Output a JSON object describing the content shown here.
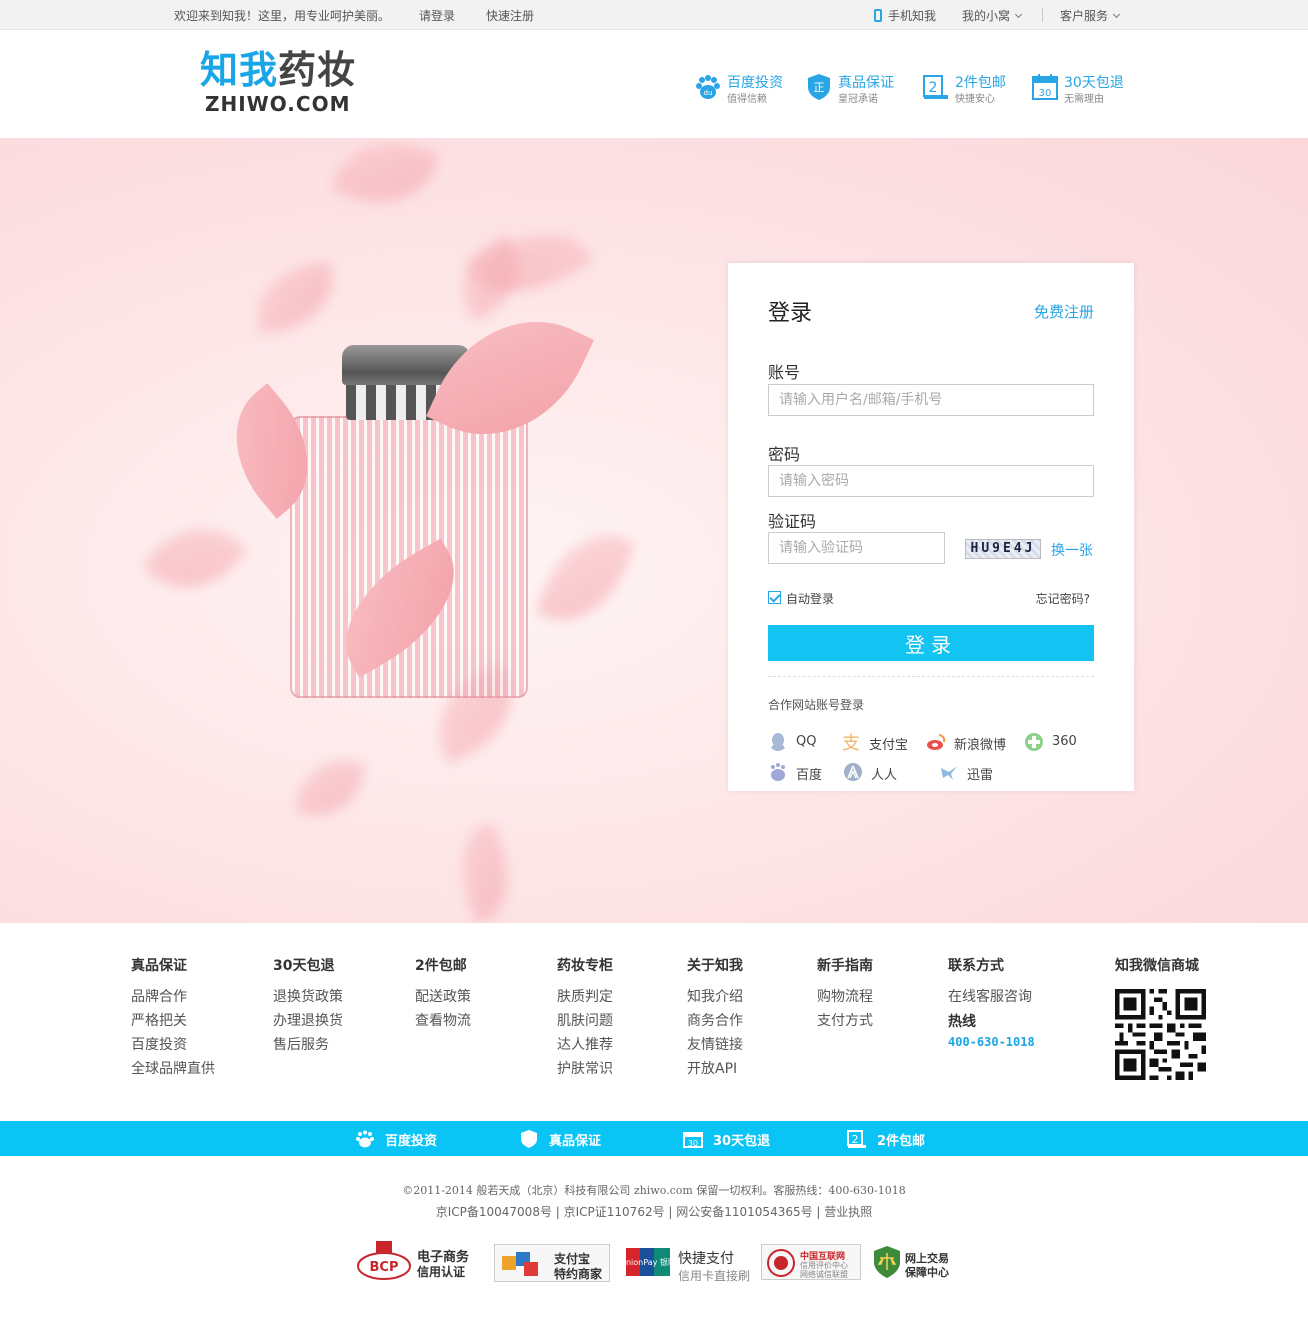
{
  "topbar": {
    "welcome": "欢迎来到知我！这里，用专业呵护美丽。",
    "login": "请登录",
    "register": "快速注册",
    "mobile": "手机知我",
    "my_home": "我的小窝",
    "service": "客户服务"
  },
  "header": {
    "logo_cn_a": "知我",
    "logo_cn_b": "药妆",
    "logo_en": "ZHIWO.COM",
    "promos": [
      {
        "title": "百度投资",
        "sub": "值得信赖",
        "icon": "baidu-paw-icon"
      },
      {
        "title": "真品保证",
        "sub": "皇冠承诺",
        "icon": "shield-icon"
      },
      {
        "title": "2件包邮",
        "sub": "快捷安心",
        "icon": "delivery-icon"
      },
      {
        "title": "30天包退",
        "sub": "无需理由",
        "icon": "calendar-icon"
      }
    ]
  },
  "login": {
    "title": "登录",
    "register_link": "免费注册",
    "account_label": "账号",
    "account_placeholder": "请输入用户名/邮箱/手机号",
    "password_label": "密码",
    "password_placeholder": "请输入密码",
    "captcha_label": "验证码",
    "captcha_placeholder": "请输入验证码",
    "captcha_text": "HU9E4J",
    "captcha_swap": "换一张",
    "auto_login": "自动登录",
    "forgot": "忘记密码?",
    "button": "登录",
    "partner_label": "合作网站账号登录",
    "social": [
      {
        "label": "QQ",
        "icon": "qq-icon"
      },
      {
        "label": "支付宝",
        "icon": "alipay-icon"
      },
      {
        "label": "新浪微博",
        "icon": "weibo-icon"
      },
      {
        "label": "360",
        "icon": "360-icon"
      },
      {
        "label": "百度",
        "icon": "baidu-icon"
      },
      {
        "label": "人人",
        "icon": "renren-icon"
      },
      {
        "label": "迅雷",
        "icon": "xunlei-icon"
      }
    ]
  },
  "footer": {
    "columns": [
      {
        "title": "真品保证",
        "links": [
          "品牌合作",
          "严格把关",
          "百度投资",
          "全球品牌直供"
        ]
      },
      {
        "title": "30天包退",
        "links": [
          "退换货政策",
          "办理退换货",
          "售后服务"
        ]
      },
      {
        "title": "2件包邮",
        "links": [
          "配送政策",
          "查看物流"
        ]
      },
      {
        "title": "药妆专柜",
        "links": [
          "肤质判定",
          "肌肤问题",
          "达人推荐",
          "护肤常识"
        ]
      },
      {
        "title": "关于知我",
        "links": [
          "知我介绍",
          "商务合作",
          "友情链接",
          "开放API"
        ]
      },
      {
        "title": "新手指南",
        "links": [
          "购物流程",
          "支付方式"
        ]
      },
      {
        "title": "联系方式",
        "links": [
          "在线客服咨询"
        ],
        "hotline_label": "热线",
        "hotline": "400-630-1018"
      }
    ],
    "wechat_title": "知我微信商城"
  },
  "strip": [
    {
      "label": "百度投资",
      "icon": "baidu-paw-icon"
    },
    {
      "label": "真品保证",
      "icon": "shield-icon"
    },
    {
      "label": "30天包退",
      "icon": "calendar-icon"
    },
    {
      "label": "2件包邮",
      "icon": "delivery-icon"
    }
  ],
  "copyright": {
    "line1": "©2011-2014 般若天成（北京）科技有限公司 zhiwo.com 保留一切权利。客服热线：400-630-1018",
    "line2": "京ICP备10047008号 | 京ICP证110762号 | 网公安备1101054365号 | 营业执照"
  },
  "certs": [
    {
      "title": "电子商务",
      "sub": "信用认证",
      "badge": "BCP"
    },
    {
      "title": "支付宝",
      "sub": "特约商家"
    },
    {
      "title": "快捷支付",
      "sub": "信用卡直接刷",
      "badge": "UnionPay 银联"
    },
    {
      "title": "中国互联网",
      "sub": "信用评价中心 网络诚信联盟"
    },
    {
      "title": "网上交易",
      "sub": "保障中心"
    }
  ],
  "colors": {
    "accent": "#29a5e6",
    "button": "#13c4f2",
    "strip": "#09c4f5"
  }
}
